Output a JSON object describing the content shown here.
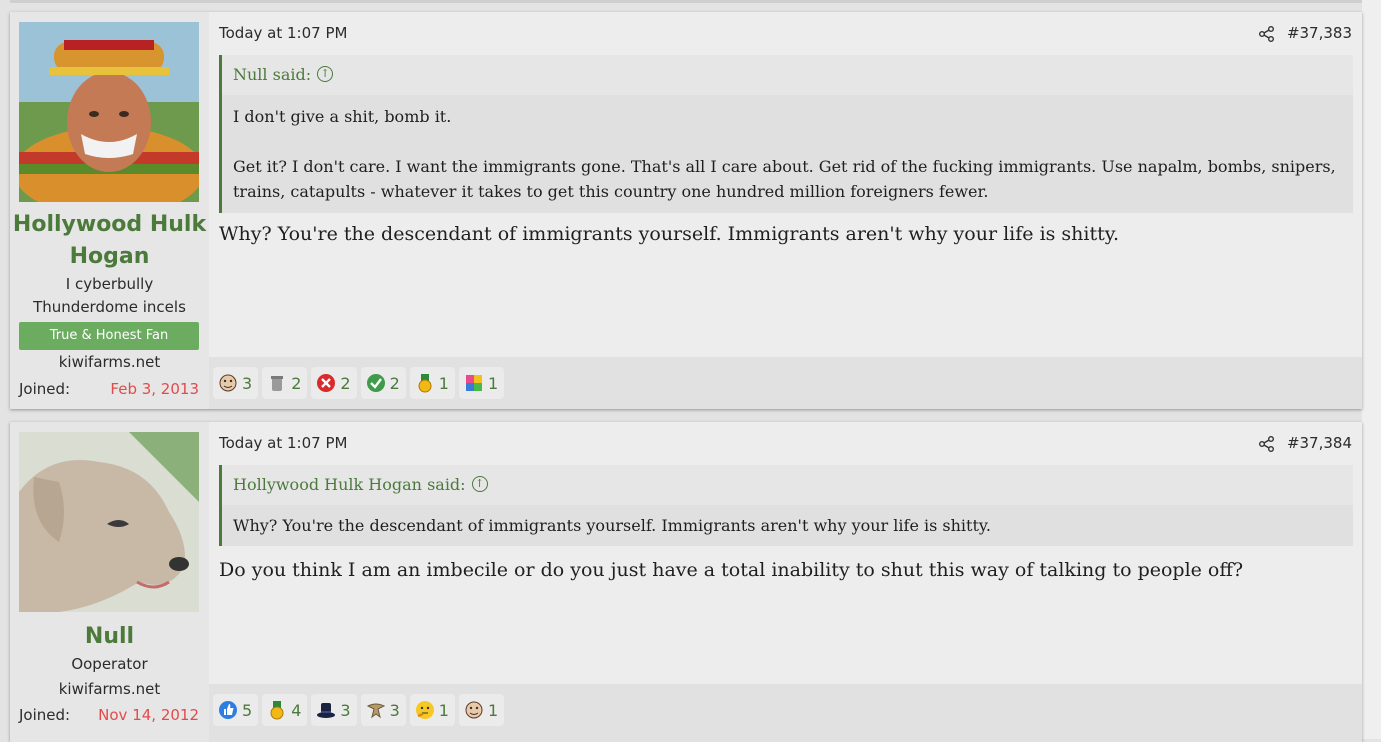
{
  "posts": [
    {
      "author": "Hollywood Hulk Hogan",
      "user_title": "I cyberbully Thunderdome incels",
      "banner": "True & Honest Fan",
      "site": "kiwifarms.net",
      "joined_label": "Joined:",
      "joined_date": "Feb 3, 2013",
      "timestamp": "Today at 1:07 PM",
      "post_number": "#37,383",
      "quote": {
        "author_said": "Null said:",
        "paragraphs": [
          "I don't give a shit, bomb it.",
          "Get it? I don't care. I want the immigrants gone. That's all I care about. Get rid of the fucking immigrants. Use napalm, bombs, snipers, trains, catapults - whatever it takes to get this country one hundred million foreigners fewer."
        ]
      },
      "message": "Why? You're the descendant of immigrants yourself. Immigrants aren't why your life is shitty.",
      "reactions": [
        {
          "icon": "face-icon",
          "count": "3"
        },
        {
          "icon": "trash-can-icon",
          "count": "2"
        },
        {
          "icon": "red-x-icon",
          "count": "2"
        },
        {
          "icon": "green-check-icon",
          "count": "2"
        },
        {
          "icon": "gold-medal-icon",
          "count": "1"
        },
        {
          "icon": "puzzle-icon",
          "count": "1"
        }
      ]
    },
    {
      "author": "Null",
      "user_title": "Ooperator",
      "site": "kiwifarms.net",
      "joined_label": "Joined:",
      "joined_date": "Nov 14, 2012",
      "timestamp": "Today at 1:07 PM",
      "post_number": "#37,384",
      "quote": {
        "author_said": "Hollywood Hulk Hogan said:",
        "paragraphs": [
          "Why? You're the descendant of immigrants yourself. Immigrants aren't why your life is shitty."
        ]
      },
      "message": "Do you think I am an imbecile or do you just have a total inability to shut this way of talking to people off?",
      "reactions": [
        {
          "icon": "thumbs-up-icon",
          "count": "5"
        },
        {
          "icon": "gold-medal-icon",
          "count": "4"
        },
        {
          "icon": "top-hat-icon",
          "count": "3"
        },
        {
          "icon": "eagle-icon",
          "count": "3"
        },
        {
          "icon": "thinking-face-icon",
          "count": "1"
        },
        {
          "icon": "face-icon",
          "count": "1"
        }
      ]
    }
  ],
  "colors": {
    "accent_green": "#4b7a3b",
    "banner_green": "#6cac61",
    "date_red": "#e24b4b"
  }
}
